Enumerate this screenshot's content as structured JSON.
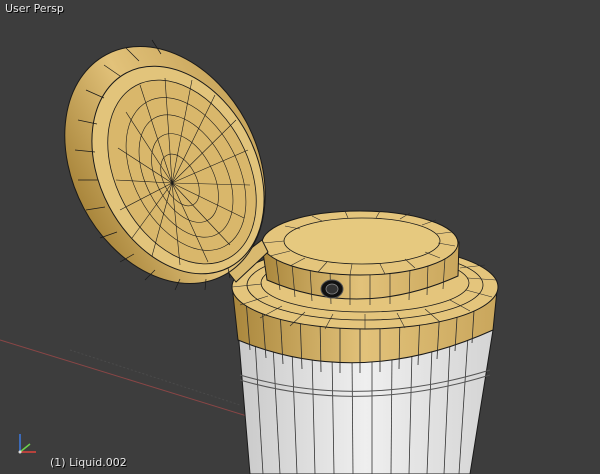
{
  "viewport": {
    "view_label": "User Persp",
    "object_label": "(1) Liquid.002"
  },
  "colors": {
    "background": "#3d3d3d",
    "grid_line": "#4a4a4a",
    "x_axis": "#9b4b4b",
    "mesh_face_gold": "#e3c47a",
    "mesh_face_gold_dark": "#b9974f",
    "mesh_face_white": "#dcdcdc",
    "wire": "#1a1a1a",
    "gizmo_x": "#e0453d",
    "gizmo_y": "#6bd14b",
    "gizmo_z": "#3d7ae0"
  },
  "icons": [
    "axis-gizmo-icon"
  ]
}
